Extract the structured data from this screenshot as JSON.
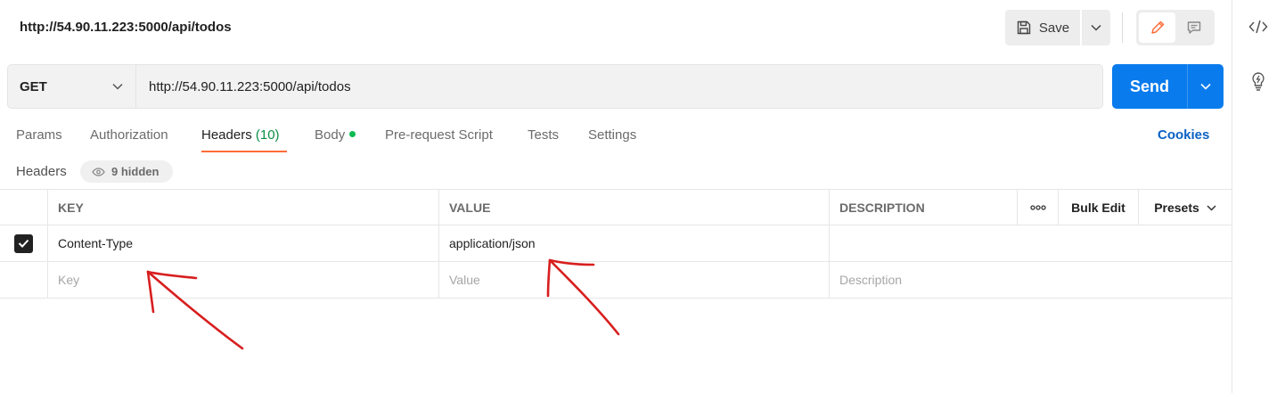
{
  "request": {
    "title": "http://54.90.11.223:5000/api/todos",
    "method": "GET",
    "url": "http://54.90.11.223:5000/api/todos"
  },
  "toolbar": {
    "save_label": "Save",
    "send_label": "Send"
  },
  "tabs": [
    {
      "label": "Params"
    },
    {
      "label": "Authorization"
    },
    {
      "label": "Headers",
      "count": "(10)",
      "active": true
    },
    {
      "label": "Body",
      "has_content": true
    },
    {
      "label": "Pre-request Script"
    },
    {
      "label": "Tests"
    },
    {
      "label": "Settings"
    }
  ],
  "cookies_label": "Cookies",
  "headers_section": {
    "label": "Headers",
    "hidden_label": "9 hidden"
  },
  "table": {
    "columns": {
      "key": "KEY",
      "value": "VALUE",
      "description": "DESCRIPTION",
      "bulk_edit": "Bulk Edit",
      "presets": "Presets"
    },
    "rows": [
      {
        "checked": true,
        "key": "Content-Type",
        "value": "application/json",
        "description": ""
      }
    ],
    "new_row": {
      "key_placeholder": "Key",
      "value_placeholder": "Value",
      "description_placeholder": "Description"
    }
  },
  "colors": {
    "send": "#097bed",
    "tab_active_underline": "#ff6c37",
    "body_dot": "#0cbb52",
    "cookies_link": "#0b62c4",
    "annotation": "#d81e1e"
  },
  "icons": {
    "save": "floppy-disk-icon",
    "edit": "pencil-icon",
    "comment": "comment-icon",
    "code": "code-icon",
    "lightbulb": "lightbulb-icon",
    "hidden": "eye-icon"
  }
}
